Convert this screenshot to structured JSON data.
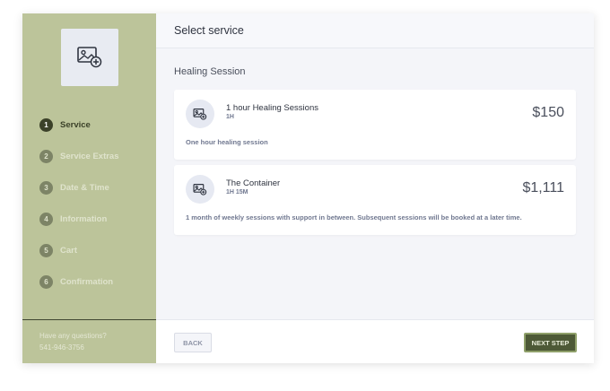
{
  "sidebar": {
    "steps": [
      {
        "num": "1",
        "label": "Service"
      },
      {
        "num": "2",
        "label": "Service Extras"
      },
      {
        "num": "3",
        "label": "Date & Time"
      },
      {
        "num": "4",
        "label": "Information"
      },
      {
        "num": "5",
        "label": "Cart"
      },
      {
        "num": "6",
        "label": "Confirmation"
      }
    ],
    "help_text": "Have any questions?",
    "help_phone": "541-946-3756",
    "avatar_icon": "image-add-icon"
  },
  "main": {
    "title": "Select service",
    "section_title": "Healing Session",
    "services": [
      {
        "name": "1 hour Healing Sessions",
        "duration": "1H",
        "price": "$150",
        "description": "One hour healing session"
      },
      {
        "name": "The Container",
        "duration": "1H 15M",
        "price": "$1,111",
        "description": "1 month of weekly sessions with support in between. Subsequent sessions will be booked at a later time."
      }
    ]
  },
  "footer": {
    "back_label": "BACK",
    "next_label": "NEXT STEP"
  },
  "colors": {
    "sidebar_bg": "#bcc49a",
    "accent": "#4d5936",
    "active_step": "#3b4129"
  }
}
